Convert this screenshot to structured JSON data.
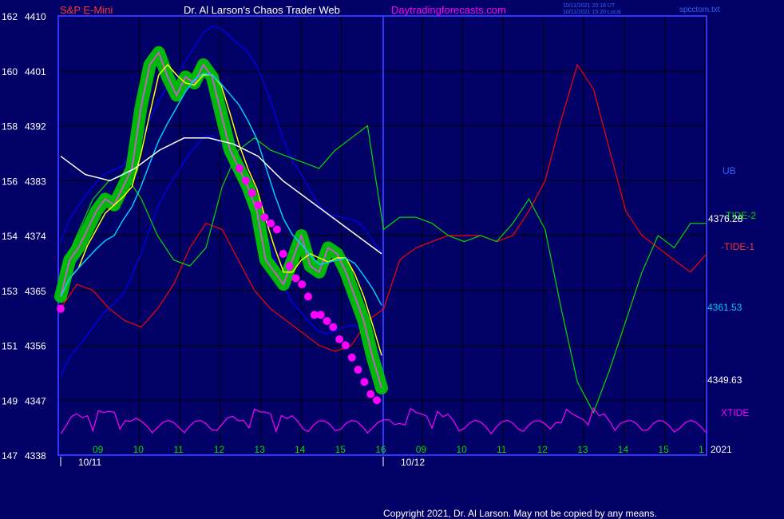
{
  "header": {
    "symbol": "S&P E-Mini",
    "title": "Dr. Al Larson's Chaos Trader Web",
    "site": "Daytradingforecasts.com",
    "stamp_1": "10/11/2021 20:16 UT",
    "stamp_2": "10/11/2021 15:20 Local",
    "file": "spcctom.txt"
  },
  "footer": {
    "copyright": "Copyright 2021, Dr. Al Larson. May not be copied by any means."
  },
  "colors": {
    "background": "#000066",
    "grid": "#000000",
    "frame": "#3333ff",
    "price": "#00cc00",
    "fast_avg": "#ffff00",
    "mid_avg": "#00ccff",
    "slow_avg": "#ffffff",
    "band": "#0000ff",
    "tide1": "#ff0000",
    "tide2": "#00dd00",
    "xtide": "#ff00ff",
    "dots": "#ff00ff"
  },
  "chart_data": {
    "type": "line",
    "y_left_ticks": [
      "162",
      "160",
      "158",
      "156",
      "154",
      "153",
      "151",
      "149",
      "147"
    ],
    "y_price_ticks": [
      4410,
      4401,
      4392,
      4383,
      4374,
      4365,
      4356,
      4347,
      4338
    ],
    "ylim": [
      4338,
      4410
    ],
    "x_hour_ticks": [
      "09",
      "10",
      "11",
      "12",
      "13",
      "14",
      "15",
      "16",
      "09",
      "10",
      "11",
      "12",
      "13",
      "14",
      "15",
      "1"
    ],
    "date_labels": [
      "10/11",
      "10/12"
    ],
    "year_label": "2021",
    "right_labels": {
      "ub": "UB",
      "tide2": "-TIDE-2",
      "price_4376": "4376.28",
      "tide1": "-TIDE-1",
      "price_4361": "4361.53",
      "price_4349": "4349.63",
      "xtide": "XTIDE"
    },
    "price_close": [
      4364,
      4370,
      4372,
      4375,
      4378,
      4380,
      4379,
      4382,
      4385,
      4395,
      4402,
      4404,
      4400,
      4397,
      4400,
      4399,
      4402,
      4400,
      4394,
      4388,
      4385,
      4382,
      4378,
      4370,
      4368,
      4366,
      4370,
      4374,
      4369,
      4368,
      4372,
      4371,
      4368,
      4364,
      4360,
      4354,
      4349
    ],
    "slow_avg": [
      4387,
      4384,
      4383,
      4385,
      4388,
      4390,
      4390,
      4389,
      4387,
      4383,
      4380,
      4377,
      4374,
      4371
    ],
    "dot_prices": [
      4385,
      4383,
      4381,
      4379,
      4377,
      4376,
      4375,
      4371,
      4369,
      4367,
      4366,
      4364,
      4361,
      4361,
      4360,
      4359,
      4357,
      4356,
      4354,
      4352,
      4350,
      4348,
      4347
    ]
  }
}
